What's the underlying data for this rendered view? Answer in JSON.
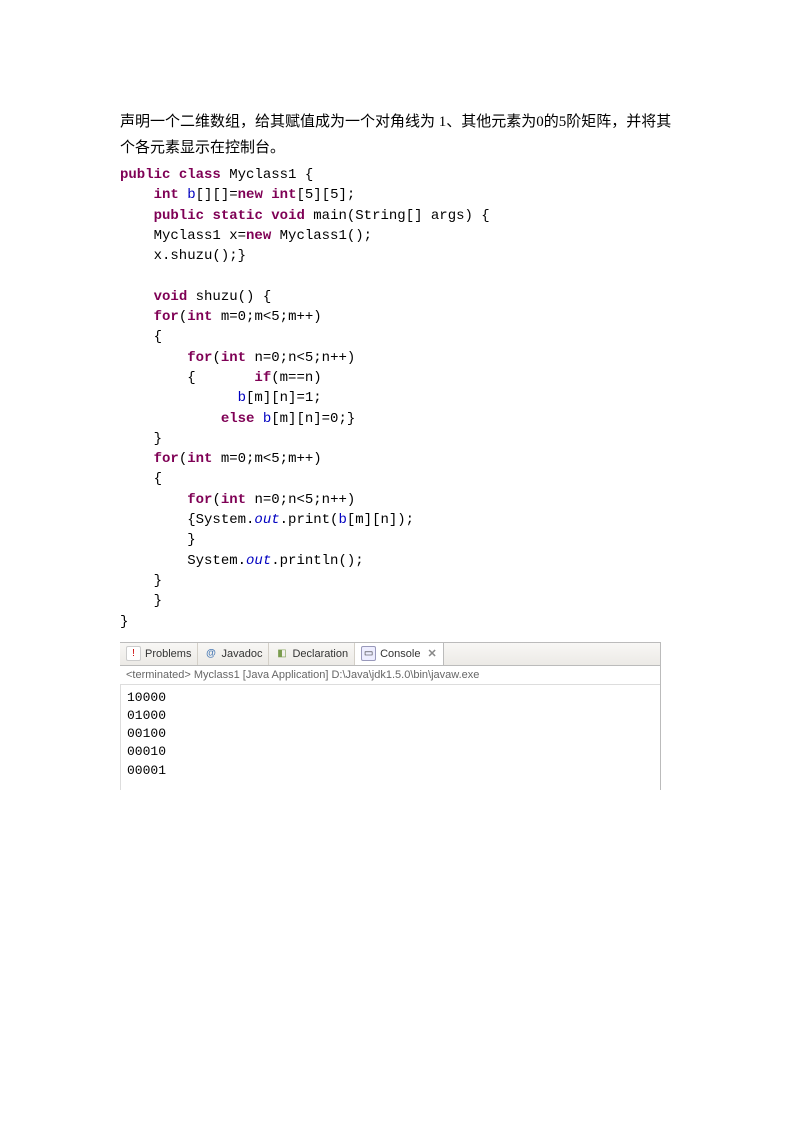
{
  "description": "声明一个二维数组，给其赋值成为一个对角线为 1、其他元素为0的5阶矩阵，并将其个各元素显示在控制台。",
  "code": {
    "l1a": "public",
    "l1b": "class",
    "l1c": " Myclass1 {",
    "l2a": "int",
    "l2b": "b",
    "l2c": "[][]=",
    "l2d": "new",
    "l2e": "int",
    "l2f": "[5][5];",
    "l3a": "public",
    "l3b": "static",
    "l3c": "void",
    "l3d": " main(String[] args) {",
    "l4a": "    Myclass1 x=",
    "l4b": "new",
    "l4c": " Myclass1();",
    "l5a": "    x.shuzu();}",
    "blank": "",
    "l6a": "void",
    "l6b": " shuzu() {",
    "l7a": "for",
    "l7b": "(",
    "l7c": "int",
    "l7d": " m=0;m<5;m++)",
    "l8": "    {",
    "l9a": "for",
    "l9b": "(",
    "l9c": "int",
    "l9d": " n=0;n<5;n++)",
    "l10a": "        {       ",
    "l10b": "if",
    "l10c": "(m==n)",
    "l11a": "b",
    "l11b": "[m][n]=1;",
    "l12a": "else",
    "l12b": "b",
    "l12c": "[m][n]=0;}",
    "l13": "    }",
    "l14a": "for",
    "l14b": "(",
    "l14c": "int",
    "l14d": " m=0;m<5;m++)",
    "l15": "    {",
    "l16a": "for",
    "l16b": "(",
    "l16c": "int",
    "l16d": " n=0;n<5;n++)",
    "l17a": "        {System.",
    "l17b": "out",
    "l17c": ".print(",
    "l17d": "b",
    "l17e": "[m][n]);",
    "l18": "        }",
    "l19a": "        System.",
    "l19b": "out",
    "l19c": ".println();",
    "l20": "    }",
    "l21": "    }",
    "l22": "}"
  },
  "tabs": {
    "problems": "Problems",
    "javadoc": "Javadoc",
    "declaration": "Declaration",
    "console": "Console"
  },
  "status": "<terminated> Myclass1 [Java Application] D:\\Java\\jdk1.5.0\\bin\\javaw.exe",
  "output": {
    "l1": "10000",
    "l2": "01000",
    "l3": "00100",
    "l4": "00010",
    "l5": "00001"
  }
}
